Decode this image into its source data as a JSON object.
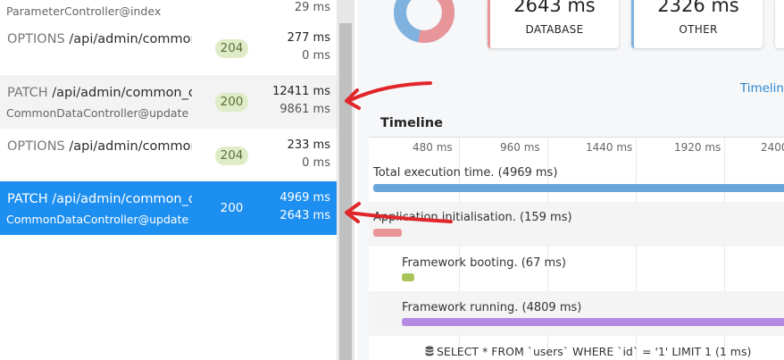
{
  "requests": [
    {
      "line1": "",
      "path": "",
      "controller": "ParameterController@index",
      "status": "",
      "time_total": "",
      "time_db": "29 ms"
    },
    {
      "line1": "OPTIONS",
      "path": "/api/admin/common_data",
      "controller": "",
      "status": "204",
      "time_total": "277 ms",
      "time_db": "0 ms"
    },
    {
      "line1": "PATCH",
      "path": "/api/admin/common_data",
      "controller": "CommonDataController@update",
      "status": "200",
      "time_total": "12411 ms",
      "time_db": "9861 ms"
    },
    {
      "line1": "OPTIONS",
      "path": "/api/admin/common_data",
      "controller": "",
      "status": "204",
      "time_total": "233 ms",
      "time_db": "0 ms"
    },
    {
      "line1": "PATCH",
      "path": "/api/admin/common_data",
      "controller": "CommonDataController@update",
      "status": "200",
      "time_total": "4969 ms",
      "time_db": "2643 ms"
    }
  ],
  "stats": {
    "database_value": "2643 ms",
    "database_label": "DATABASE",
    "other_value": "2326 ms",
    "other_label": "OTHER"
  },
  "donut": {
    "database_fraction": 0.532,
    "database_color": "#e8959a",
    "other_color": "#7fb2de"
  },
  "timeline": {
    "link": "Timelin",
    "title": "Timeline",
    "ticks": [
      "480 ms",
      "960 ms",
      "1440 ms",
      "1920 ms",
      "2400"
    ],
    "rows": [
      {
        "label": "Total execution time. (4969 ms)",
        "color": "#6ba6d9"
      },
      {
        "label": "Application initialisation. (159 ms)",
        "color": "#e8959a"
      },
      {
        "label": "Framework booting. (67 ms)",
        "color": "#a9c45b"
      },
      {
        "label": "Framework running. (4809 ms)",
        "color": "#b48be0"
      }
    ],
    "query": "SELECT * FROM `users` WHERE `id` = '1' LIMIT 1 (1 ms)"
  },
  "colors": {
    "selected": "#1d8ff0",
    "annotation_arrow": "#e0262b"
  }
}
